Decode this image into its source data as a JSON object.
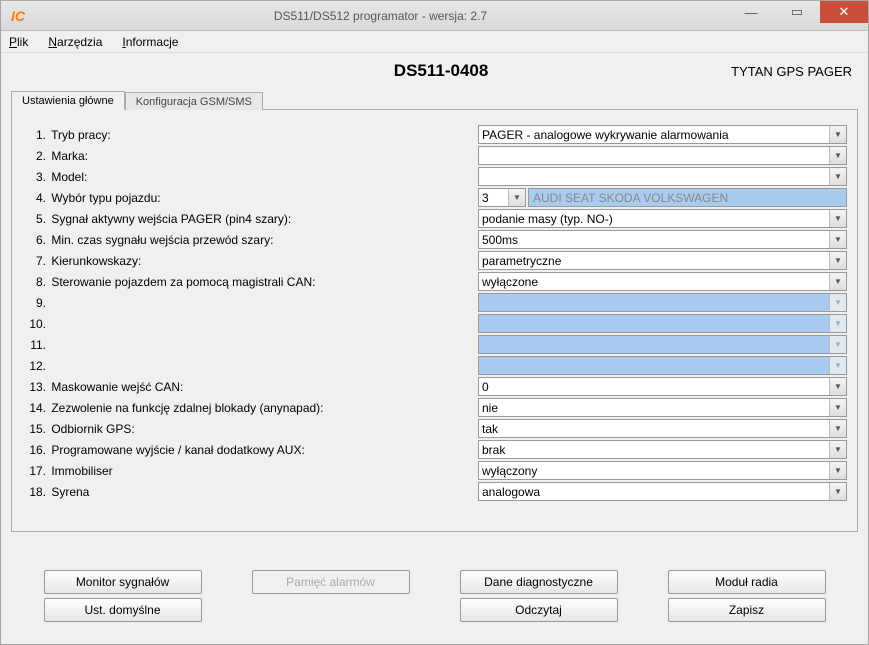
{
  "window": {
    "title": "DS511/DS512 programator - wersja:  2.7",
    "icon_text": "IC"
  },
  "menu": {
    "items": [
      "Plik",
      "Narzędzia",
      "Informacje"
    ]
  },
  "header": {
    "device": "DS511-0408",
    "product": "TYTAN GPS PAGER"
  },
  "tabs": [
    {
      "label": "Ustawienia główne",
      "active": true
    },
    {
      "label": "Konfiguracja GSM/SMS",
      "active": false
    }
  ],
  "settings": [
    {
      "num": "1.",
      "label": "Tryb pracy:",
      "value": "PAGER - analogowe wykrywanie alarmowania",
      "type": "combo"
    },
    {
      "num": "2.",
      "label": "Marka:",
      "value": "",
      "type": "combo"
    },
    {
      "num": "3.",
      "label": "Model:",
      "value": "",
      "type": "combo"
    },
    {
      "num": "4.",
      "label": "Wybór typu pojazdu:",
      "value": "3",
      "type": "combo_short",
      "extra": "AUDI SEAT SKODA VOLKSWAGEN"
    },
    {
      "num": "5.",
      "label": "Sygnał aktywny wejścia PAGER (pin4 szary):",
      "value": "podanie masy (typ. NO-)",
      "type": "combo"
    },
    {
      "num": "6.",
      "label": "Min. czas sygnału wejścia przewód szary:",
      "value": "500ms",
      "type": "combo"
    },
    {
      "num": "7.",
      "label": "Kierunkowskazy:",
      "value": "parametryczne",
      "type": "combo"
    },
    {
      "num": "8.",
      "label": "Sterowanie pojazdem za pomocą magistrali CAN:",
      "value": "wyłączone",
      "type": "combo"
    },
    {
      "num": "9.",
      "label": "",
      "value": "",
      "type": "locked"
    },
    {
      "num": "10.",
      "label": "",
      "value": "",
      "type": "locked"
    },
    {
      "num": "11.",
      "label": "",
      "value": "",
      "type": "locked"
    },
    {
      "num": "12.",
      "label": "",
      "value": "",
      "type": "locked"
    },
    {
      "num": "13.",
      "label": "Maskowanie wejść CAN:",
      "value": "0",
      "type": "combo"
    },
    {
      "num": "14.",
      "label": "Zezwolenie na funkcję zdalnej blokady (anynapad):",
      "value": "nie",
      "type": "combo"
    },
    {
      "num": "15.",
      "label": "Odbiornik GPS:",
      "value": "tak",
      "type": "combo"
    },
    {
      "num": "16.",
      "label": "Programowane wyjście / kanał dodatkowy AUX:",
      "value": "brak",
      "type": "combo"
    },
    {
      "num": "17.",
      "label": "Immobiliser",
      "value": "wyłączony",
      "type": "combo"
    },
    {
      "num": "18.",
      "label": "Syrena",
      "value": "analogowa",
      "type": "combo"
    }
  ],
  "buttons": {
    "row1": {
      "col1": "Monitor sygnałów",
      "col2": "Pamięć alarmów",
      "col3": "Dane diagnostyczne",
      "col4": "Moduł radia"
    },
    "row2": {
      "col1": "Ust. domyślne",
      "col3": "Odczytaj",
      "col4": "Zapisz"
    }
  }
}
